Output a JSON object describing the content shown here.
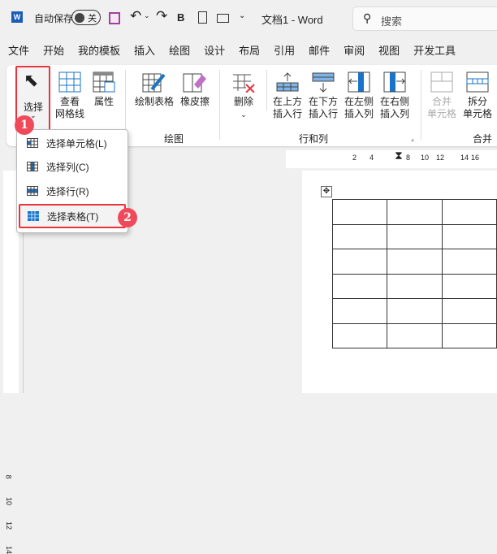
{
  "titlebar": {
    "autosave_label": "自动保存",
    "autosave_state": "关",
    "bold": "B",
    "title": "文档1 - Word",
    "search_placeholder": "搜索"
  },
  "tabs": [
    "文件",
    "开始",
    "我的模板",
    "插入",
    "绘图",
    "设计",
    "布局",
    "引用",
    "邮件",
    "审阅",
    "视图",
    "开发工具"
  ],
  "ribbon": {
    "select": "选择",
    "view_grid": [
      "查看",
      "网格线"
    ],
    "properties": "属性",
    "draw_table": "绘制表格",
    "eraser": "橡皮擦",
    "delete": "删除",
    "insert_above": [
      "在上方",
      "插入行"
    ],
    "insert_below": [
      "在下方",
      "插入行"
    ],
    "insert_left": [
      "在左侧",
      "插入列"
    ],
    "insert_right": [
      "在右侧",
      "插入列"
    ],
    "merge_cells": [
      "合并",
      "单元格"
    ],
    "split_cells": [
      "拆分",
      "单元格"
    ],
    "groups": {
      "draw": "绘图",
      "rows_cols": "行和列",
      "merge": "合并"
    }
  },
  "menu": [
    "选择单元格(L)",
    "选择列(C)",
    "选择行(R)",
    "选择表格(T)"
  ],
  "badges": [
    "1",
    "2"
  ],
  "ruler": [
    "2",
    "4",
    "8",
    "10",
    "12",
    "14",
    "16"
  ],
  "vruler": [
    "8",
    "10",
    "12",
    "14"
  ],
  "accent": "#1a73c8",
  "highlight": "#e8323c"
}
